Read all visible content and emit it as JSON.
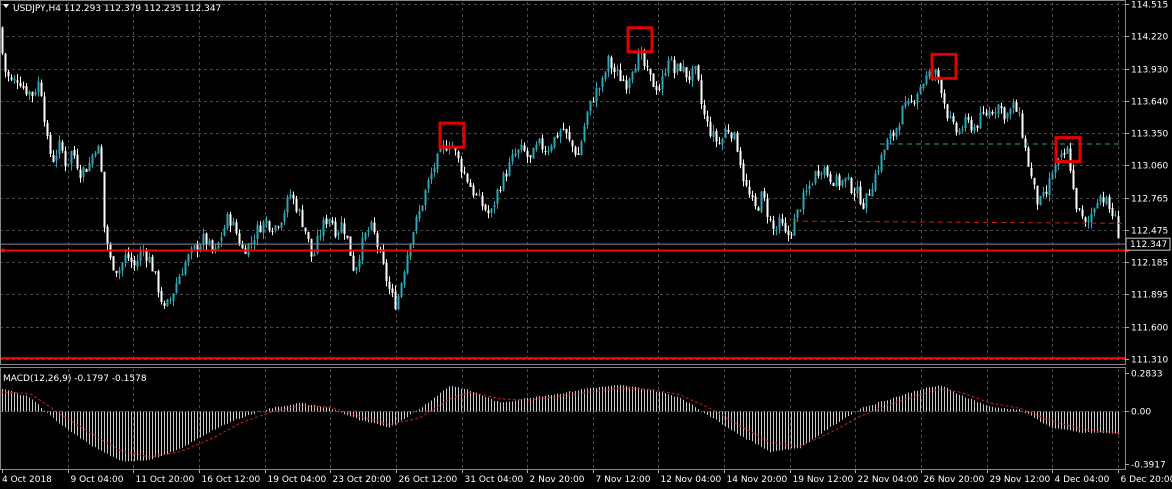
{
  "header": {
    "symbol_line": "USDJPY,H4  112.293 112.379 112.235 112.347",
    "symbol_menu_icon": "triangle-down-icon"
  },
  "indicator": {
    "label": "MACD(12,26,9) -0.1797 -0.1578"
  },
  "colors": {
    "background": "#000000",
    "grid": "#4a4a4a",
    "candle_up": "#2ea6b5",
    "candle_down": "#ffffff",
    "level_line": "#ff0000",
    "dashed_line": "#c02020",
    "teal_dashed": "#2aa0a0",
    "markers": "#e00000",
    "macd_hist": "#c8c8c8",
    "macd_signal": "#c02020"
  },
  "chart_data": {
    "type": "candlestick",
    "symbol": "USDJPY",
    "timeframe": "H4",
    "price_axis": {
      "ticks": [
        "114.515",
        "114.220",
        "113.930",
        "113.640",
        "113.350",
        "113.060",
        "112.765",
        "112.475",
        "112.185",
        "111.895",
        "111.600",
        "111.310"
      ],
      "ylim": [
        111.285,
        114.53
      ],
      "current_price": "112.347"
    },
    "time_axis": {
      "labels": [
        "4 Oct 2018",
        "9 Oct 04:00",
        "11 Oct 20:00",
        "16 Oct 12:00",
        "19 Oct 04:00",
        "23 Oct 20:00",
        "26 Oct 12:00",
        "31 Oct 04:00",
        "2 Nov 20:00",
        "7 Nov 12:00",
        "12 Nov 04:00",
        "14 Nov 20:00",
        "19 Nov 12:00",
        "22 Nov 04:00",
        "26 Nov 20:00",
        "29 Nov 12:00",
        "4 Dec 04:00",
        "6 Dec 20:00"
      ]
    },
    "price_path": [
      [
        0,
        114.3
      ],
      [
        3,
        113.95
      ],
      [
        8,
        113.85
      ],
      [
        12,
        113.8
      ],
      [
        18,
        113.85
      ],
      [
        24,
        113.75
      ],
      [
        32,
        113.7
      ],
      [
        38,
        113.8
      ],
      [
        42,
        113.7
      ],
      [
        46,
        113.3
      ],
      [
        52,
        113.1
      ],
      [
        60,
        113.25
      ],
      [
        66,
        113.05
      ],
      [
        72,
        113.2
      ],
      [
        80,
        113.0
      ],
      [
        88,
        113.05
      ],
      [
        96,
        113.25
      ],
      [
        100,
        113.15
      ],
      [
        104,
        112.5
      ],
      [
        110,
        112.2
      ],
      [
        118,
        112.1
      ],
      [
        126,
        112.25
      ],
      [
        134,
        112.15
      ],
      [
        142,
        112.3
      ],
      [
        150,
        112.2
      ],
      [
        158,
        111.95
      ],
      [
        164,
        111.75
      ],
      [
        170,
        111.85
      ],
      [
        178,
        112.05
      ],
      [
        186,
        112.2
      ],
      [
        194,
        112.3
      ],
      [
        204,
        112.4
      ],
      [
        214,
        112.25
      ],
      [
        222,
        112.45
      ],
      [
        228,
        112.6
      ],
      [
        234,
        112.5
      ],
      [
        242,
        112.3
      ],
      [
        250,
        112.35
      ],
      [
        258,
        112.5
      ],
      [
        266,
        112.55
      ],
      [
        274,
        112.5
      ],
      [
        282,
        112.6
      ],
      [
        290,
        112.8
      ],
      [
        298,
        112.65
      ],
      [
        306,
        112.45
      ],
      [
        312,
        112.2
      ],
      [
        318,
        112.4
      ],
      [
        324,
        112.55
      ],
      [
        330,
        112.6
      ],
      [
        336,
        112.45
      ],
      [
        342,
        112.55
      ],
      [
        348,
        112.35
      ],
      [
        354,
        112.1
      ],
      [
        360,
        112.3
      ],
      [
        366,
        112.45
      ],
      [
        372,
        112.5
      ],
      [
        378,
        112.3
      ],
      [
        384,
        112.1
      ],
      [
        390,
        111.9
      ],
      [
        396,
        111.8
      ],
      [
        402,
        112.05
      ],
      [
        410,
        112.4
      ],
      [
        418,
        112.6
      ],
      [
        426,
        112.85
      ],
      [
        434,
        113.05
      ],
      [
        442,
        113.2
      ],
      [
        450,
        113.28
      ],
      [
        458,
        113.1
      ],
      [
        466,
        112.95
      ],
      [
        474,
        112.8
      ],
      [
        482,
        112.7
      ],
      [
        490,
        112.6
      ],
      [
        498,
        112.85
      ],
      [
        506,
        113.0
      ],
      [
        514,
        113.15
      ],
      [
        522,
        113.2
      ],
      [
        530,
        113.1
      ],
      [
        538,
        113.25
      ],
      [
        546,
        113.2
      ],
      [
        554,
        113.3
      ],
      [
        562,
        113.4
      ],
      [
        570,
        113.25
      ],
      [
        578,
        113.15
      ],
      [
        586,
        113.5
      ],
      [
        594,
        113.7
      ],
      [
        602,
        113.8
      ],
      [
        608,
        114.0
      ],
      [
        614,
        113.9
      ],
      [
        620,
        113.85
      ],
      [
        626,
        113.8
      ],
      [
        632,
        113.95
      ],
      [
        640,
        114.05
      ],
      [
        646,
        113.9
      ],
      [
        652,
        113.8
      ],
      [
        660,
        113.75
      ],
      [
        668,
        114.05
      ],
      [
        674,
        113.9
      ],
      [
        680,
        113.95
      ],
      [
        688,
        113.85
      ],
      [
        696,
        113.9
      ],
      [
        702,
        113.55
      ],
      [
        708,
        113.4
      ],
      [
        714,
        113.3
      ],
      [
        720,
        113.25
      ],
      [
        726,
        113.4
      ],
      [
        732,
        113.35
      ],
      [
        738,
        113.2
      ],
      [
        744,
        112.9
      ],
      [
        750,
        112.75
      ],
      [
        756,
        112.65
      ],
      [
        762,
        112.8
      ],
      [
        768,
        112.6
      ],
      [
        774,
        112.45
      ],
      [
        780,
        112.55
      ],
      [
        786,
        112.4
      ],
      [
        792,
        112.5
      ],
      [
        800,
        112.7
      ],
      [
        808,
        112.85
      ],
      [
        816,
        113.0
      ],
      [
        822,
        113.05
      ],
      [
        830,
        112.95
      ],
      [
        838,
        112.9
      ],
      [
        846,
        112.92
      ],
      [
        852,
        112.85
      ],
      [
        858,
        112.8
      ],
      [
        864,
        112.7
      ],
      [
        870,
        112.85
      ],
      [
        878,
        113.05
      ],
      [
        886,
        113.25
      ],
      [
        894,
        113.35
      ],
      [
        902,
        113.55
      ],
      [
        910,
        113.6
      ],
      [
        918,
        113.75
      ],
      [
        926,
        113.85
      ],
      [
        934,
        113.9
      ],
      [
        940,
        113.8
      ],
      [
        946,
        113.55
      ],
      [
        952,
        113.4
      ],
      [
        958,
        113.35
      ],
      [
        966,
        113.45
      ],
      [
        974,
        113.4
      ],
      [
        982,
        113.5
      ],
      [
        990,
        113.55
      ],
      [
        998,
        113.6
      ],
      [
        1006,
        113.5
      ],
      [
        1014,
        113.6
      ],
      [
        1020,
        113.45
      ],
      [
        1026,
        113.15
      ],
      [
        1032,
        112.9
      ],
      [
        1038,
        112.7
      ],
      [
        1046,
        112.8
      ],
      [
        1052,
        113.0
      ],
      [
        1060,
        113.1
      ],
      [
        1068,
        113.2
      ],
      [
        1074,
        112.75
      ],
      [
        1080,
        112.6
      ],
      [
        1086,
        112.5
      ],
      [
        1092,
        112.65
      ],
      [
        1098,
        112.8
      ],
      [
        1104,
        112.75
      ],
      [
        1110,
        112.65
      ],
      [
        1116,
        112.55
      ],
      [
        1120,
        112.35
      ]
    ],
    "horizontal_lines": [
      {
        "price": 112.29,
        "style": "solid"
      },
      {
        "price": 111.32,
        "style": "solid"
      }
    ],
    "segment_lines": [
      {
        "x_from": 880,
        "x_to": 1122,
        "price": 113.25,
        "style": "teal-dashed"
      },
      {
        "x_from": 794,
        "x_to": 1122,
        "price_from": 112.555,
        "price_to": 112.535,
        "style": "red-dashed"
      }
    ],
    "markers": [
      {
        "x_center": 452,
        "price_center": 113.33
      },
      {
        "x_center": 640,
        "price_center": 114.19
      },
      {
        "x_center": 944,
        "price_center": 113.95
      },
      {
        "x_center": 1068,
        "price_center": 113.2
      }
    ],
    "macd": {
      "ticks": [
        "0.2833",
        "0.00",
        "-0.3917"
      ],
      "ylim": [
        -0.42,
        0.31
      ],
      "histogram_path": [
        [
          0,
          0.17
        ],
        [
          30,
          0.1
        ],
        [
          60,
          -0.1
        ],
        [
          90,
          -0.25
        ],
        [
          120,
          -0.37
        ],
        [
          150,
          -0.36
        ],
        [
          180,
          -0.28
        ],
        [
          210,
          -0.15
        ],
        [
          240,
          -0.05
        ],
        [
          270,
          0.02
        ],
        [
          300,
          0.06
        ],
        [
          330,
          0.02
        ],
        [
          360,
          -0.07
        ],
        [
          390,
          -0.12
        ],
        [
          420,
          0.02
        ],
        [
          450,
          0.19
        ],
        [
          470,
          0.15
        ],
        [
          500,
          0.06
        ],
        [
          530,
          0.1
        ],
        [
          560,
          0.13
        ],
        [
          590,
          0.17
        ],
        [
          620,
          0.19
        ],
        [
          650,
          0.16
        ],
        [
          680,
          0.1
        ],
        [
          710,
          -0.04
        ],
        [
          740,
          -0.18
        ],
        [
          770,
          -0.3
        ],
        [
          800,
          -0.27
        ],
        [
          830,
          -0.12
        ],
        [
          860,
          0.02
        ],
        [
          890,
          0.09
        ],
        [
          920,
          0.16
        ],
        [
          940,
          0.19
        ],
        [
          960,
          0.12
        ],
        [
          990,
          0.03
        ],
        [
          1020,
          0.01
        ],
        [
          1050,
          -0.12
        ],
        [
          1080,
          -0.16
        ],
        [
          1100,
          -0.16
        ],
        [
          1120,
          -0.17
        ]
      ],
      "signal_path": [
        [
          0,
          0.14
        ],
        [
          30,
          0.13
        ],
        [
          60,
          -0.02
        ],
        [
          90,
          -0.16
        ],
        [
          120,
          -0.29
        ],
        [
          150,
          -0.34
        ],
        [
          180,
          -0.3
        ],
        [
          210,
          -0.21
        ],
        [
          240,
          -0.09
        ],
        [
          270,
          -0.01
        ],
        [
          300,
          0.04
        ],
        [
          330,
          0.03
        ],
        [
          360,
          -0.04
        ],
        [
          390,
          -0.1
        ],
        [
          420,
          -0.05
        ],
        [
          450,
          0.09
        ],
        [
          470,
          0.14
        ],
        [
          500,
          0.09
        ],
        [
          530,
          0.08
        ],
        [
          560,
          0.11
        ],
        [
          590,
          0.14
        ],
        [
          620,
          0.17
        ],
        [
          650,
          0.16
        ],
        [
          680,
          0.12
        ],
        [
          710,
          0.02
        ],
        [
          740,
          -0.11
        ],
        [
          770,
          -0.23
        ],
        [
          800,
          -0.26
        ],
        [
          830,
          -0.16
        ],
        [
          860,
          -0.04
        ],
        [
          890,
          0.05
        ],
        [
          920,
          0.12
        ],
        [
          940,
          0.16
        ],
        [
          960,
          0.14
        ],
        [
          990,
          0.06
        ],
        [
          1020,
          0.02
        ],
        [
          1050,
          -0.07
        ],
        [
          1080,
          -0.13
        ],
        [
          1100,
          -0.15
        ],
        [
          1120,
          -0.158
        ]
      ]
    }
  }
}
